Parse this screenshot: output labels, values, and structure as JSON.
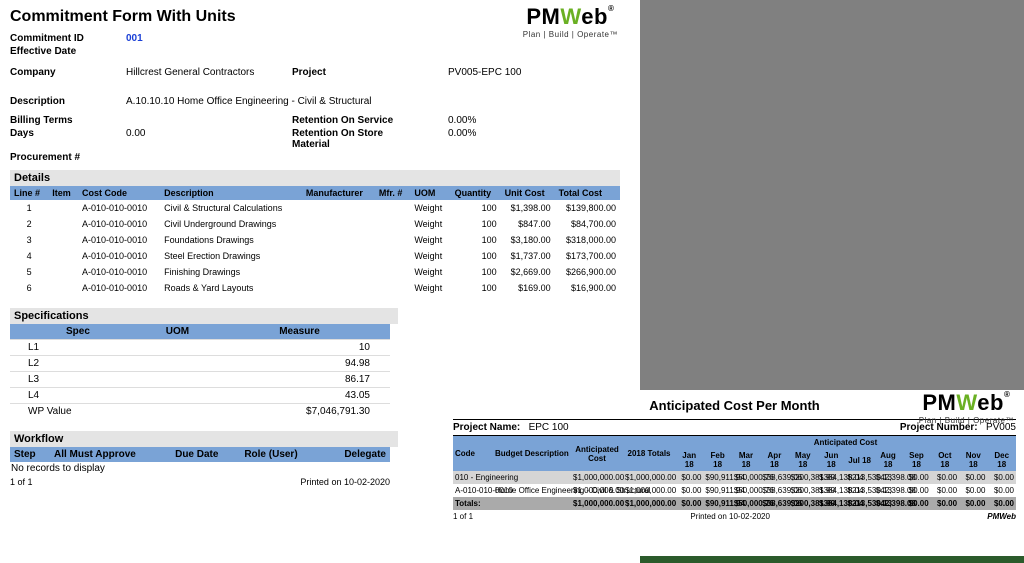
{
  "brand": {
    "pm": "PM",
    "w": "W",
    "eb": "eb",
    "tagline": "Plan | Build | Operate",
    "reg": "®",
    "tm": "™"
  },
  "left": {
    "title": "Commitment Form With Units",
    "commitment_id_lbl": "Commitment ID",
    "commitment_id": "001",
    "effective_date_lbl": "Effective Date",
    "effective_date": "",
    "company_lbl": "Company",
    "company": "Hillcrest General Contractors",
    "project_lbl": "Project",
    "project": "PV005-EPC 100",
    "description_lbl": "Description",
    "description": "A.10.10.10 Home Office Engineering - Civil & Structural",
    "billing_terms_lbl": "Billing Terms",
    "billing_terms": "",
    "days_lbl": "Days",
    "days": "0.00",
    "procurement_lbl": "Procurement #",
    "procurement": "",
    "ret_service_lbl": "Retention On Service",
    "ret_service": "0.00%",
    "ret_store_lbl": "Retention On Store Material",
    "ret_store": "0.00%",
    "details_lbl": "Details",
    "details_cols": [
      "Line #",
      "Item",
      "Cost Code",
      "Description",
      "Manufacturer",
      "Mfr. #",
      "UOM",
      "Quantity",
      "Unit Cost",
      "Total Cost"
    ],
    "details_rows": [
      {
        "line": "1",
        "item": "",
        "code": "A-010-010-0010",
        "desc": "Civil & Structural Calculations",
        "mfr": "",
        "mfrno": "",
        "uom": "Weight",
        "qty": "100",
        "unit": "$1,398.00",
        "total": "$139,800.00"
      },
      {
        "line": "2",
        "item": "",
        "code": "A-010-010-0010",
        "desc": "Civil Underground Drawings",
        "mfr": "",
        "mfrno": "",
        "uom": "Weight",
        "qty": "100",
        "unit": "$847.00",
        "total": "$84,700.00"
      },
      {
        "line": "3",
        "item": "",
        "code": "A-010-010-0010",
        "desc": "Foundations Drawings",
        "mfr": "",
        "mfrno": "",
        "uom": "Weight",
        "qty": "100",
        "unit": "$3,180.00",
        "total": "$318,000.00"
      },
      {
        "line": "4",
        "item": "",
        "code": "A-010-010-0010",
        "desc": "Steel Erection Drawings",
        "mfr": "",
        "mfrno": "",
        "uom": "Weight",
        "qty": "100",
        "unit": "$1,737.00",
        "total": "$173,700.00"
      },
      {
        "line": "5",
        "item": "",
        "code": "A-010-010-0010",
        "desc": "Finishing Drawings",
        "mfr": "",
        "mfrno": "",
        "uom": "Weight",
        "qty": "100",
        "unit": "$2,669.00",
        "total": "$266,900.00"
      },
      {
        "line": "6",
        "item": "",
        "code": "A-010-010-0010",
        "desc": "Roads & Yard Layouts",
        "mfr": "",
        "mfrno": "",
        "uom": "Weight",
        "qty": "100",
        "unit": "$169.00",
        "total": "$16,900.00"
      }
    ],
    "specs_lbl": "Specifications",
    "specs_cols": [
      "Spec",
      "UOM",
      "Measure"
    ],
    "specs_rows": [
      {
        "spec": "L1",
        "uom": "",
        "measure": "10"
      },
      {
        "spec": "L2",
        "uom": "",
        "measure": "94.98"
      },
      {
        "spec": "L3",
        "uom": "",
        "measure": "86.17"
      },
      {
        "spec": "L4",
        "uom": "",
        "measure": "43.05"
      },
      {
        "spec": "WP Value",
        "uom": "",
        "measure": "$7,046,791.30"
      }
    ],
    "workflow_lbl": "Workflow",
    "workflow_cols": [
      "Step",
      "All Must Approve",
      "Due Date",
      "Role (User)",
      "Delegate"
    ],
    "workflow_empty": "No records to display",
    "page_of": "1 of 1",
    "printed": "Printed on 10-02-2020"
  },
  "right": {
    "title": "Anticipated Cost Per Month",
    "proj_name_lbl": "Project Name:",
    "proj_name": "EPC 100",
    "proj_num_lbl": "Project Number:",
    "proj_num": "PV005",
    "anticip_lbl": "Anticipated Cost",
    "cols_fixed": [
      "Code",
      "Budget Description",
      "Anticipated Cost",
      "2018 Totals"
    ],
    "months": [
      "Jan 18",
      "Feb 18",
      "Mar 18",
      "Apr 18",
      "May 18",
      "Jun 18",
      "Jul 18",
      "Aug 18",
      "Sep 18",
      "Oct 18",
      "Nov 18",
      "Dec 18"
    ],
    "rows": [
      {
        "sh": true,
        "code": "010 - Engineering",
        "desc": "",
        "ac": "$1,000,000.00",
        "tot": "$1,000,000.00",
        "m": [
          "$0.00",
          "$90,911.94",
          "$50,000.76",
          "$38,639.06",
          "$200,381.99",
          "$364,138.04",
          "$213,530.13",
          "$42,398.08",
          "$0.00",
          "$0.00",
          "$0.00",
          "$0.00"
        ]
      },
      {
        "sh": false,
        "code": "A-010-010-0010",
        "desc": "Home Office Engineering - Civil & Structural",
        "ac": "$1,000,000.00",
        "tot": "$1,000,000.00",
        "m": [
          "$0.00",
          "$90,911.94",
          "$50,000.76",
          "$38,639.06",
          "$200,381.99",
          "$364,138.04",
          "$213,530.13",
          "$42,398.08",
          "$0.00",
          "$0.00",
          "$0.00",
          "$0.00"
        ]
      }
    ],
    "totals": {
      "code": "Totals:",
      "desc": "",
      "ac": "$1,000,000.00",
      "tot": "$1,000,000.00",
      "m": [
        "$0.00",
        "$90,911.94",
        "$50,000.76",
        "$38,639.06",
        "$200,381.99",
        "$364,138.04",
        "$213,530.13",
        "$42,398.08",
        "$0.00",
        "$0.00",
        "$0.00",
        "$0.00"
      ]
    },
    "page_of": "1 of 1",
    "printed": "Printed on 10-02-2020",
    "brand": "PMWeb"
  }
}
